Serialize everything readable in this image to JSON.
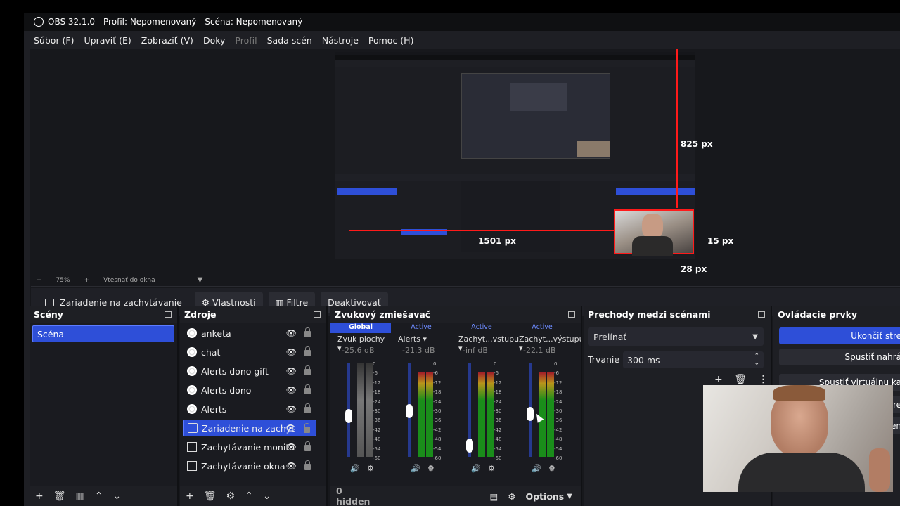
{
  "window": {
    "title": "OBS 32.1.0 - Profil: Nepomenovaný - Scéna: Nepomenovaný"
  },
  "menu": [
    "Súbor (F)",
    "Upraviť (E)",
    "Zobraziť (V)",
    "Doky",
    "Profil",
    "Sada scén",
    "Nástroje",
    "Pomoc (H)"
  ],
  "preview": {
    "labels": {
      "top": "825 px",
      "left": "1501 px",
      "right": "15 px",
      "bottom": "28 px"
    }
  },
  "zoombar": {
    "minus": "−",
    "zoom": "75%",
    "plus": "+",
    "fit": "Vtesnať do okna"
  },
  "source_toolbar": {
    "source": "Zariadenie na zachytávanie",
    "properties": "Vlastnosti",
    "filters": "Filtre",
    "deactivate": "Deaktivovať"
  },
  "scenes": {
    "title": "Scény",
    "items": [
      "Scéna"
    ]
  },
  "sources": {
    "title": "Zdroje",
    "items": [
      {
        "label": "anketa",
        "icon": "browser-icon"
      },
      {
        "label": "chat",
        "icon": "browser-icon"
      },
      {
        "label": "Alerts dono gift",
        "icon": "browser-icon"
      },
      {
        "label": "Alerts dono",
        "icon": "browser-icon"
      },
      {
        "label": "Alerts",
        "icon": "browser-icon"
      },
      {
        "label": "Zariadenie na zachyt",
        "icon": "camera-icon"
      },
      {
        "label": "Zachytávanie monito",
        "icon": "monitor-icon"
      },
      {
        "label": "Zachytávanie okna",
        "icon": "window-icon"
      }
    ]
  },
  "mixer": {
    "title": "Zvukový zmiešavač",
    "channels": [
      {
        "badge": "Global",
        "name": "Zvuk plochy",
        "db": "-25.6 dB",
        "level": 0.0,
        "fader": 0.42
      },
      {
        "badge": "Active",
        "name": "Alerts",
        "db": "-21.3 dB",
        "level": 0.9,
        "fader": 0.48
      },
      {
        "badge": "Active",
        "name": "Zachyt...vstupu",
        "db": "-inf dB",
        "level": 0.9,
        "fader": 0.05
      },
      {
        "badge": "Active",
        "name": "Zachyt...výstupu",
        "db": "-22.1 dB",
        "level": 0.9,
        "fader": 0.45
      }
    ],
    "scale": [
      "0",
      "-6",
      "-12",
      "-18",
      "-24",
      "-30",
      "-36",
      "-42",
      "-48",
      "-54",
      "-60"
    ],
    "hidden": "0 hidden",
    "options": "Options"
  },
  "transitions": {
    "title": "Prechody medzi scénami",
    "selected": "Prelínať",
    "duration_label": "Trvanie",
    "duration": "300 ms"
  },
  "controls": {
    "title": "Ovládacie prvky",
    "buttons": [
      "Ukončiť stre",
      "Spustiť nahrá",
      "Spustiť virtuálnu ka",
      "re",
      "en"
    ]
  },
  "colors": {
    "accent": "#2e4fd8",
    "red": "#ff1a1a",
    "green": "#22cc22"
  }
}
